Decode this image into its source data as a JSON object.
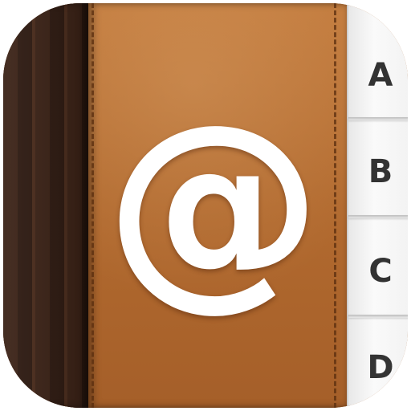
{
  "icon": {
    "symbol": "@",
    "tabs": [
      {
        "label": "A"
      },
      {
        "label": "B"
      },
      {
        "label": "C"
      },
      {
        "label": "D"
      }
    ]
  },
  "colors": {
    "leather": "#b56a31",
    "spine": "#3b2216",
    "page_tabs": "#f4f4f4",
    "symbol": "#ffffff",
    "tab_text": "#333333"
  }
}
